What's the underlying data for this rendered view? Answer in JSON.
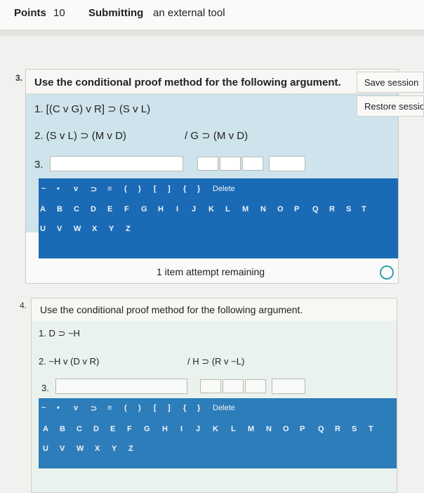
{
  "header": {
    "points_label": "Points",
    "points_value": "10",
    "submitting_bold": "Submitting",
    "submitting_rest": "an external tool"
  },
  "session": {
    "save": "Save session",
    "restore": "Restore session"
  },
  "q3": {
    "number": "3.",
    "prompt": "Use the conditional proof method for the following argument.",
    "premise1": "1.  [(C v G) v R] ⊃ (S v L)",
    "premise2": "2.  (S v L) ⊃ (M v D)",
    "conclusion": "/ G ⊃ (M v D)",
    "step_label": "3.",
    "attempts": "1 item attempt remaining"
  },
  "q4": {
    "number": "4.",
    "prompt": "Use the conditional proof method for the following argument.",
    "premise1": "1.  D ⊃ ~H",
    "premise2": "2.  ~H v (D v R)",
    "conclusion": "/ H ⊃ (R v ~L)",
    "step_label": "3."
  },
  "keyboard": {
    "symbols": [
      "~",
      "•",
      "v",
      "⊃",
      "≡",
      "(",
      ")",
      "[",
      "]",
      "{",
      "}",
      "Delete"
    ],
    "row1": [
      "A",
      "B",
      "C",
      "D",
      "E",
      "F",
      "G",
      "H",
      "I",
      "J",
      "K",
      "L",
      "M",
      "N",
      "O",
      "P",
      "Q",
      "R",
      "S",
      "T"
    ],
    "row2": [
      "U",
      "V",
      "W",
      "X",
      "Y",
      "Z"
    ]
  }
}
